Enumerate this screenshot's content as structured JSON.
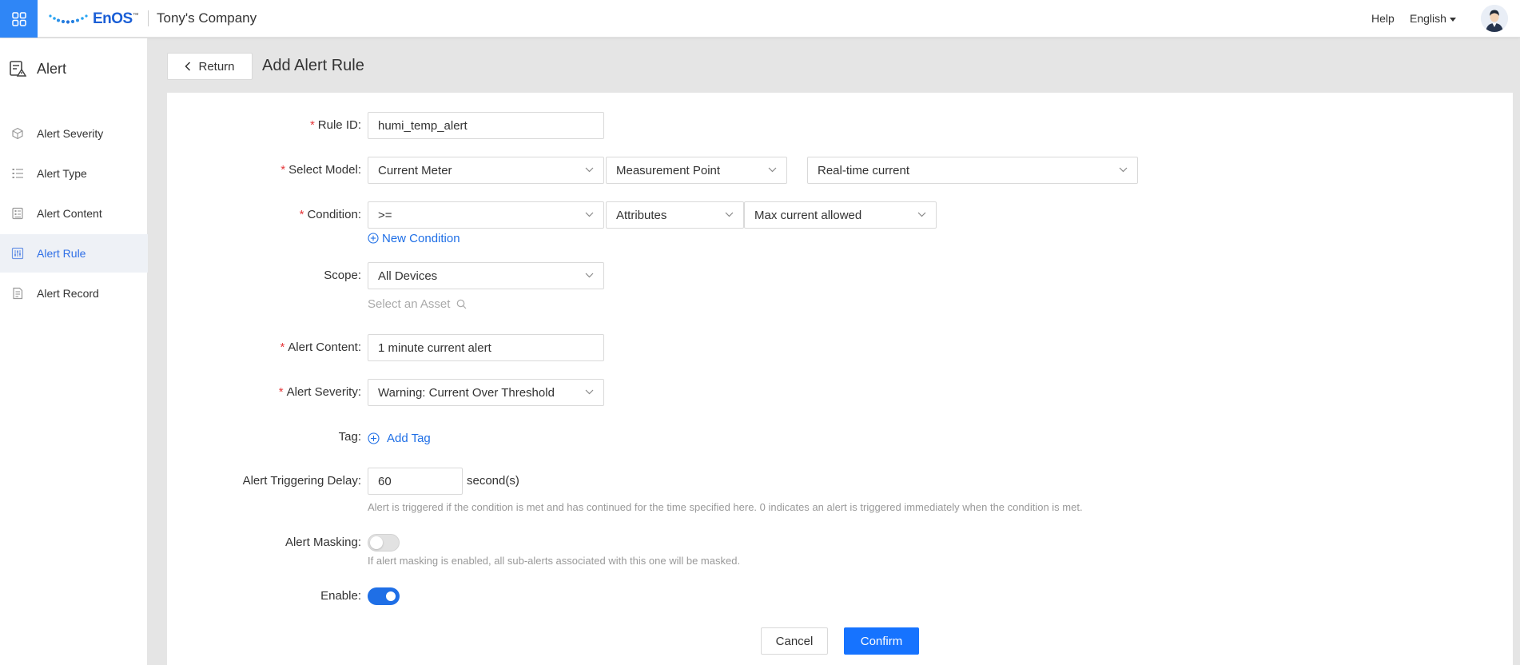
{
  "header": {
    "logo_text": "EnOS",
    "logo_tm": "™",
    "company": "Tony's Company",
    "help": "Help",
    "language": "English"
  },
  "sidebar": {
    "title": "Alert",
    "items": [
      {
        "label": "Alert Severity",
        "icon": "cube-icon"
      },
      {
        "label": "Alert Type",
        "icon": "list-icon"
      },
      {
        "label": "Alert Content",
        "icon": "document-icon"
      },
      {
        "label": "Alert Rule",
        "icon": "sliders-icon",
        "active": true
      },
      {
        "label": "Alert Record",
        "icon": "record-icon"
      }
    ]
  },
  "page": {
    "return_label": "Return",
    "title": "Add Alert Rule"
  },
  "form": {
    "rule_id": {
      "label": "Rule ID",
      "value": "humi_temp_alert"
    },
    "select_model": {
      "label": "Select Model",
      "model": "Current Meter",
      "point_type": "Measurement Point",
      "point": "Real-time current"
    },
    "condition": {
      "label": "Condition",
      "operator": ">=",
      "source": "Attributes",
      "attribute": "Max current allowed",
      "new_condition": "New Condition"
    },
    "scope": {
      "label": "Scope",
      "value": "All Devices",
      "asset_placeholder": "Select an Asset"
    },
    "alert_content": {
      "label": "Alert Content",
      "value": "1 minute current alert"
    },
    "alert_severity": {
      "label": "Alert Severity",
      "value": "Warning: Current Over Threshold"
    },
    "tag": {
      "label": "Tag",
      "add_label": "Add Tag"
    },
    "delay": {
      "label": "Alert Triggering Delay",
      "value": "60",
      "unit": "second(s)",
      "hint": "Alert is triggered if the condition is met and has continued for the time specified here. 0 indicates an alert is triggered immediately when the condition is met."
    },
    "masking": {
      "label": "Alert Masking",
      "enabled": false,
      "hint": "If alert masking is enabled, all sub-alerts associated with this one will be masked."
    },
    "enable": {
      "label": "Enable",
      "enabled": true
    },
    "colon": ":"
  },
  "actions": {
    "cancel": "Cancel",
    "confirm": "Confirm"
  },
  "colors": {
    "accent": "#1673ff",
    "required": "#e5383b",
    "apps_button": "#2f86f6"
  }
}
